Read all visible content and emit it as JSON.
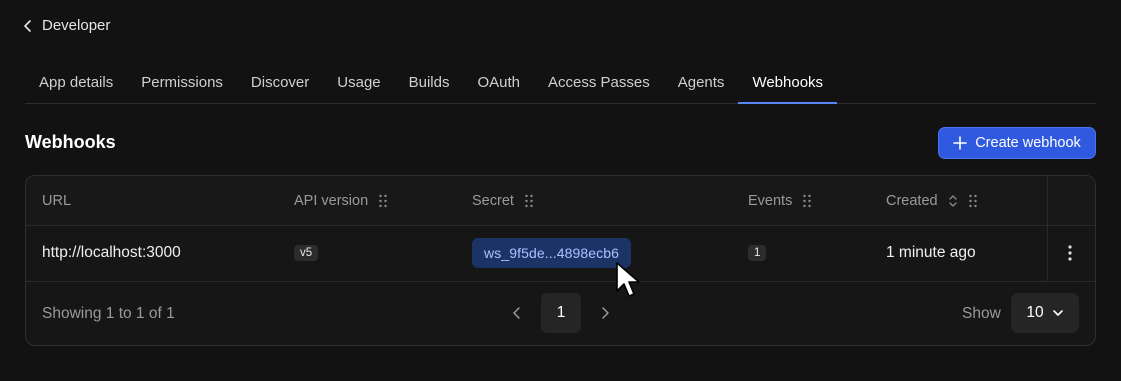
{
  "nav": {
    "back_label": "Developer",
    "back_icon": "chevron-left-icon"
  },
  "tabs": [
    {
      "label": "App details",
      "active": false
    },
    {
      "label": "Permissions",
      "active": false
    },
    {
      "label": "Discover",
      "active": false
    },
    {
      "label": "Usage",
      "active": false
    },
    {
      "label": "Builds",
      "active": false
    },
    {
      "label": "OAuth",
      "active": false
    },
    {
      "label": "Access Passes",
      "active": false
    },
    {
      "label": "Agents",
      "active": false
    },
    {
      "label": "Webhooks",
      "active": true
    }
  ],
  "section": {
    "title": "Webhooks"
  },
  "create_button": {
    "label": "Create webhook",
    "icon": "plus-icon"
  },
  "table": {
    "columns": [
      {
        "label": "URL"
      },
      {
        "label": "API version"
      },
      {
        "label": "Secret"
      },
      {
        "label": "Events"
      },
      {
        "label": "Created"
      }
    ],
    "rows": [
      {
        "url": "http://localhost:3000",
        "api_version": "v5",
        "secret": "ws_9f5de...4898ecb6",
        "events": "1",
        "created": "1 minute ago"
      }
    ]
  },
  "pagination": {
    "showing_text": "Showing 1 to 1 of 1",
    "current_page": "1",
    "show_label": "Show",
    "page_size": "10"
  },
  "colors": {
    "background": "#121212",
    "accent": "#2f5ae0",
    "active_tab_underline": "#5b86f5",
    "secret_bg": "#1c3366",
    "secret_text": "#a9c2ff"
  }
}
